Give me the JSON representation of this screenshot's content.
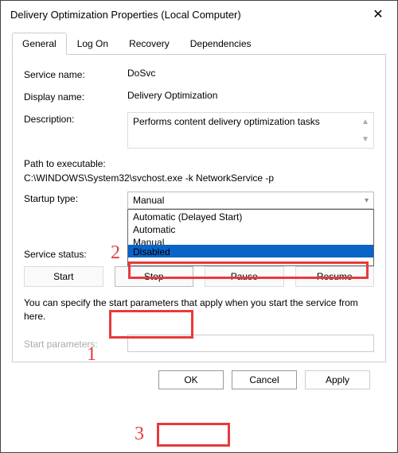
{
  "window": {
    "title": "Delivery Optimization Properties (Local Computer)"
  },
  "tabs": {
    "t0": "General",
    "t1": "Log On",
    "t2": "Recovery",
    "t3": "Dependencies"
  },
  "labels": {
    "service_name": "Service name:",
    "display_name": "Display name:",
    "description": "Description:",
    "path": "Path to executable:",
    "startup": "Startup type:",
    "status": "Service status:",
    "start_params": "Start parameters:"
  },
  "values": {
    "service_name": "DoSvc",
    "display_name": "Delivery Optimization",
    "description": "Performs content delivery optimization tasks",
    "path": "C:\\WINDOWS\\System32\\svchost.exe -k NetworkService -p",
    "startup_display": "Manual",
    "status": ""
  },
  "startup_options": {
    "o0": "Automatic (Delayed Start)",
    "o1": "Automatic",
    "o2": "Manual",
    "o3": "Disabled"
  },
  "buttons": {
    "start": "Start",
    "stop": "Stop",
    "pause": "Pause",
    "resume": "Resume",
    "ok": "OK",
    "cancel": "Cancel",
    "apply": "Apply"
  },
  "note": "You can specify the start parameters that apply when you start the service from here.",
  "annotations": {
    "n1": "1",
    "n2": "2",
    "n3": "3"
  }
}
